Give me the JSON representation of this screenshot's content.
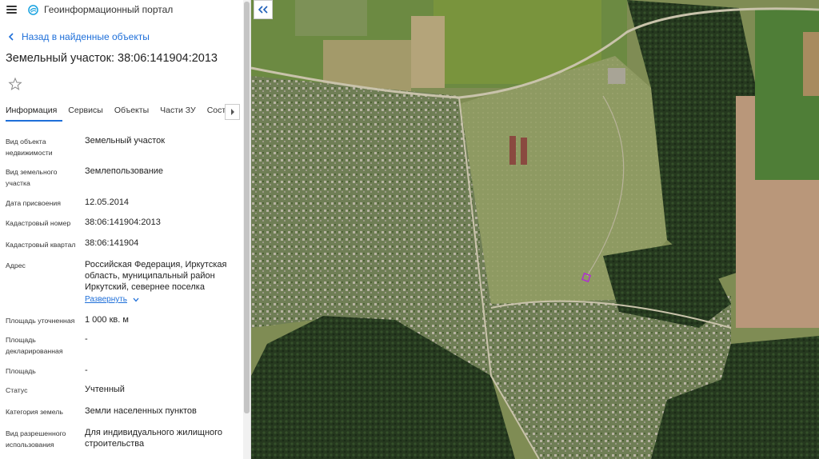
{
  "app": {
    "title": "Геоинформационный портал"
  },
  "nav": {
    "back_label": "Назад в найденные объекты"
  },
  "object": {
    "title": "Земельный участок: 38:06:141904:2013"
  },
  "tabs": [
    {
      "label": "Информация",
      "active": true
    },
    {
      "label": "Сервисы",
      "active": false
    },
    {
      "label": "Объекты",
      "active": false
    },
    {
      "label": "Части ЗУ",
      "active": false
    },
    {
      "label": "Состав",
      "active": false
    }
  ],
  "attributes": [
    {
      "label": [
        "Вид объекта",
        "недвижимости"
      ],
      "value": [
        "Земельный участок"
      ]
    },
    {
      "label": [
        "Вид земельного",
        "участка"
      ],
      "value": [
        "Землепользование"
      ]
    },
    {
      "label": [
        "Дата присвоения"
      ],
      "value": [
        "12.05.2014"
      ]
    },
    {
      "label": [
        "Кадастровый номер"
      ],
      "value": [
        "38:06:141904:2013"
      ]
    },
    {
      "label": [
        "Кадастровый квартал"
      ],
      "value": [
        "38:06:141904"
      ]
    },
    {
      "label": [
        "Адрес"
      ],
      "value": [
        "Российская Федерация, Иркутская",
        "область, муниципальный район",
        "Иркутский, севернее поселка"
      ]
    },
    {
      "label": [
        "Площадь уточненная"
      ],
      "value": [
        "1 000 кв. м"
      ]
    },
    {
      "label": [
        "Площадь",
        "декларированная"
      ],
      "value": [
        "-"
      ]
    },
    {
      "label": [
        "Площадь"
      ],
      "value": [
        "-"
      ]
    },
    {
      "label": [
        "Статус"
      ],
      "value": [
        "Учтенный"
      ]
    },
    {
      "label": [
        "Категория земель"
      ],
      "value": [
        "Земли населенных пунктов"
      ]
    },
    {
      "label": [
        "Вид разрешенного",
        "использования"
      ],
      "value": [
        "Для индивидуального жилищного",
        "строительства"
      ]
    }
  ],
  "address_expand_label": "Развернуть",
  "colors": {
    "accent": "#1e6fd9",
    "parcel_outline": "#b030d0"
  },
  "icons": {
    "menu": "hamburger-icon",
    "logo": "portal-logo-icon",
    "back": "chevron-left-icon",
    "favorite": "star-outline-icon",
    "tabs_scroll": "chevron-right-icon",
    "expand": "chevron-down-icon",
    "collapse_panel": "double-chevron-left-icon"
  }
}
